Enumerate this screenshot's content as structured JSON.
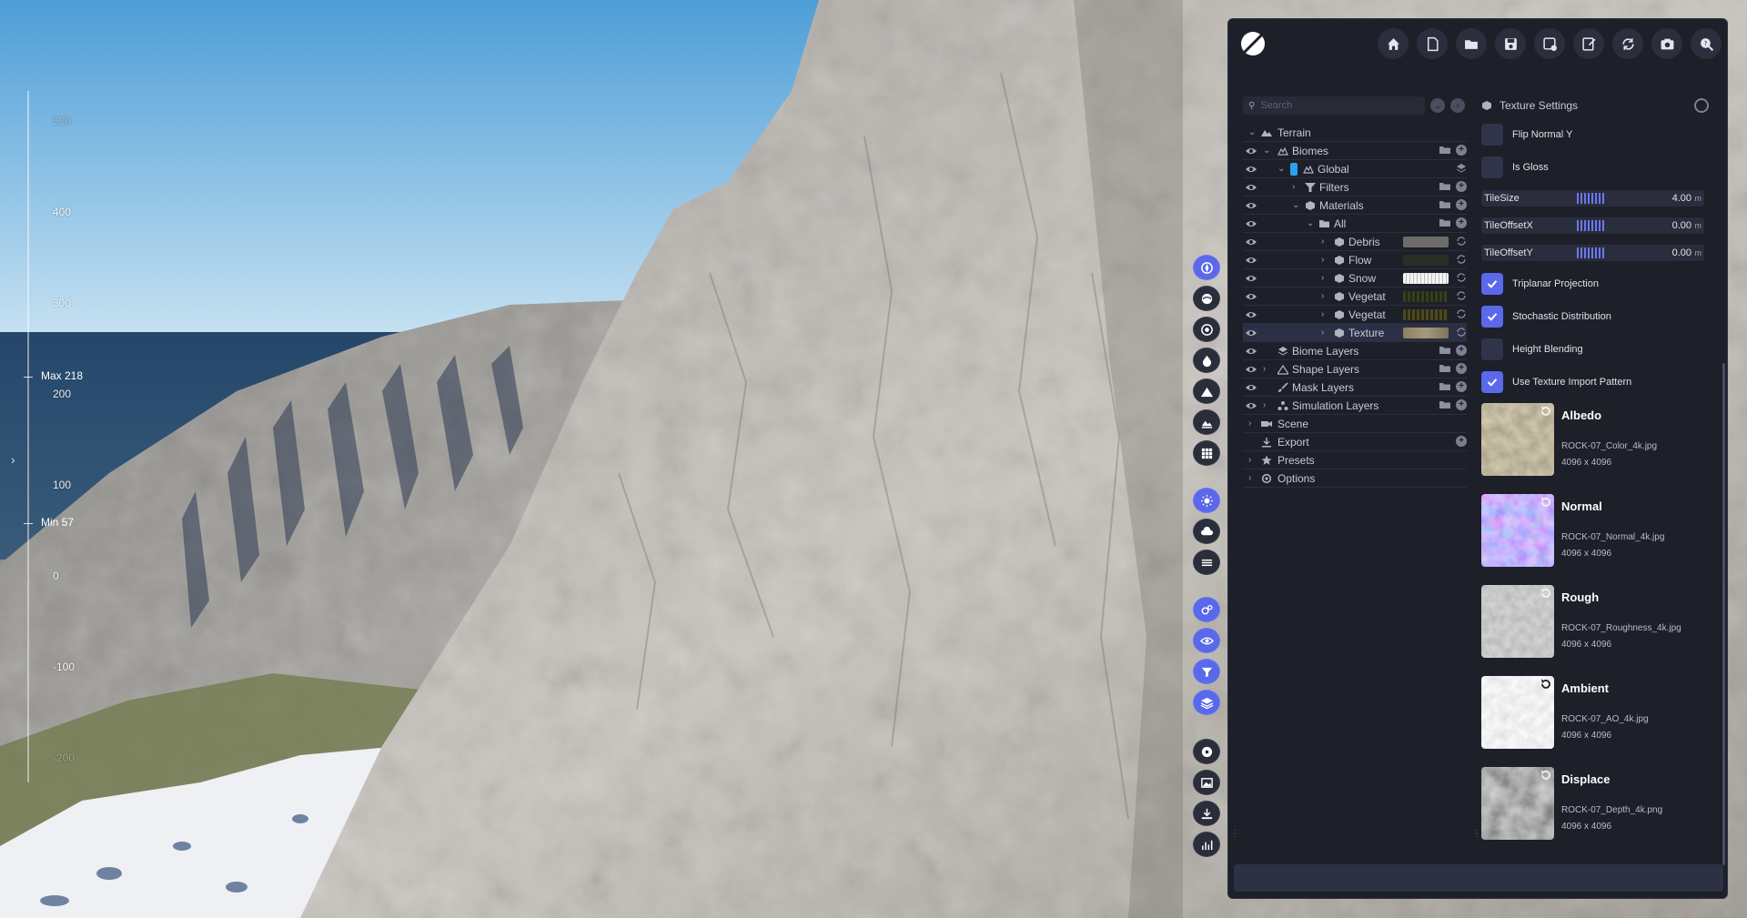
{
  "viewport": {
    "ruler_labels": [
      "500",
      "400",
      "300",
      "200",
      "100",
      "0",
      "-100",
      "-200"
    ],
    "max_label": "Max 218",
    "min_label": "Min 57"
  },
  "header": {
    "buttons": [
      "home-icon",
      "new-file-icon",
      "open-folder-icon",
      "save-icon",
      "save-as-icon",
      "export-file-icon",
      "sync-icon",
      "camera-icon",
      "help-search-icon"
    ]
  },
  "tree": {
    "search_placeholder": "Search",
    "items": [
      {
        "label": "Terrain"
      },
      {
        "label": "Biomes"
      },
      {
        "label": "Global"
      },
      {
        "label": "Filters"
      },
      {
        "label": "Materials"
      },
      {
        "label": "All"
      },
      {
        "label": "Debris"
      },
      {
        "label": "Flow"
      },
      {
        "label": "Snow"
      },
      {
        "label": "Vegetat"
      },
      {
        "label": "Vegetat"
      },
      {
        "label": "Texture"
      },
      {
        "label": "Biome Layers"
      },
      {
        "label": "Shape Layers"
      },
      {
        "label": "Mask Layers"
      },
      {
        "label": "Simulation Layers"
      },
      {
        "label": "Scene"
      },
      {
        "label": "Export"
      },
      {
        "label": "Presets"
      },
      {
        "label": "Options"
      }
    ]
  },
  "texture_settings": {
    "title": "Texture Settings",
    "flip_normal_y": {
      "label": "Flip Normal Y",
      "checked": false
    },
    "is_gloss": {
      "label": "Is Gloss",
      "checked": false
    },
    "tile_size": {
      "label": "TileSize",
      "value": "4.00",
      "unit": "m"
    },
    "tile_offset_x": {
      "label": "TileOffsetX",
      "value": "0.00",
      "unit": "m"
    },
    "tile_offset_y": {
      "label": "TileOffsetY",
      "value": "0.00",
      "unit": "m"
    },
    "triplanar": {
      "label": "Triplanar Projection",
      "checked": true
    },
    "stochastic": {
      "label": "Stochastic Distribution",
      "checked": true
    },
    "height_blending": {
      "label": "Height Blending",
      "checked": false
    },
    "import_pattern": {
      "label": "Use Texture Import Pattern",
      "checked": true
    },
    "textures": [
      {
        "title": "Albedo",
        "file": "ROCK-07_Color_4k.jpg",
        "size": "4096 x 4096"
      },
      {
        "title": "Normal",
        "file": "ROCK-07_Normal_4k.jpg",
        "size": "4096 x 4096"
      },
      {
        "title": "Rough",
        "file": "ROCK-07_Roughness_4k.jpg",
        "size": "4096 x 4096"
      },
      {
        "title": "Ambient",
        "file": "ROCK-07_AO_4k.jpg",
        "size": "4096 x 4096"
      },
      {
        "title": "Displace",
        "file": "ROCK-07_Depth_4k.png",
        "size": "4096 x 4096"
      }
    ]
  },
  "colors": {
    "accent": "#5a68ea",
    "panel_bg": "#1d1f29"
  }
}
